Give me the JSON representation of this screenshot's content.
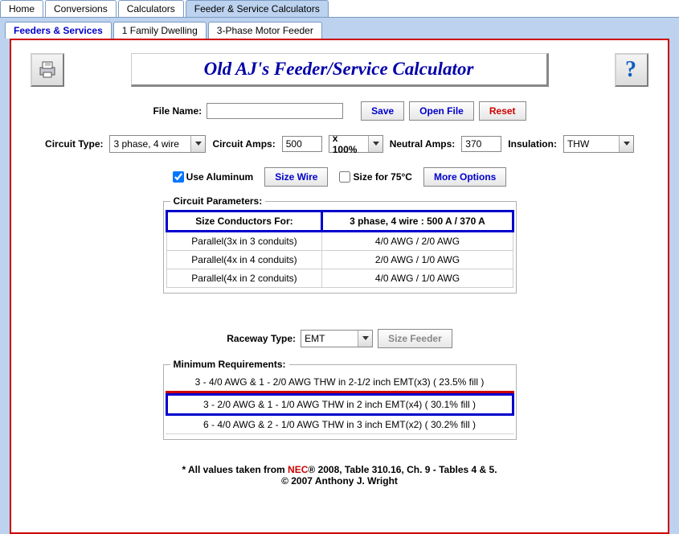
{
  "top_tabs": [
    "Home",
    "Conversions",
    "Calculators",
    "Feeder & Service Calculators"
  ],
  "top_tabs_selected": 3,
  "sub_tabs": [
    "Feeders & Services",
    "1 Family Dwelling",
    "3-Phase Motor Feeder"
  ],
  "sub_tabs_selected": 0,
  "title": "Old AJ's Feeder/Service Calculator",
  "file_name_label": "File Name:",
  "file_name_value": "",
  "buttons": {
    "save": "Save",
    "open": "Open File",
    "reset": "Reset",
    "size_wire": "Size Wire",
    "more_options": "More Options",
    "size_feeder": "Size Feeder"
  },
  "labels": {
    "circuit_type": "Circuit Type:",
    "circuit_amps": "Circuit Amps:",
    "multiplier": "x 100%",
    "neutral_amps": "Neutral Amps:",
    "insulation": "Insulation:",
    "use_aluminum": "Use Aluminum",
    "size_75": "Size for 75°C",
    "raceway_type": "Raceway Type:"
  },
  "values": {
    "circuit_type": "3 phase, 4 wire",
    "circuit_amps": "500",
    "neutral_amps": "370",
    "insulation": "THW",
    "use_aluminum": true,
    "size_75": false,
    "raceway_type": "EMT"
  },
  "params_legend": "Circuit Parameters:",
  "params_header": {
    "left": "Size Conductors For:",
    "right": "3 phase, 4 wire   :   500 A / 370 A"
  },
  "params_rows": [
    {
      "left": "Parallel(3x in 3 conduits)",
      "right": "4/0 AWG / 2/0 AWG"
    },
    {
      "left": "Parallel(4x in 4 conduits)",
      "right": "2/0 AWG / 1/0 AWG"
    },
    {
      "left": "Parallel(4x in 2 conduits)",
      "right": "4/0 AWG / 1/0 AWG"
    }
  ],
  "minreq_legend": "Minimum Requirements:",
  "minreq_rows": [
    "3 - 4/0 AWG & 1 - 2/0 AWG THW in 2-1/2 inch EMT(x3)  ( 23.5% fill )",
    "3 - 2/0 AWG & 1 - 1/0 AWG THW in 2 inch EMT(x4)  ( 30.1% fill )",
    "6 - 4/0 AWG & 2 - 1/0 AWG THW in 3 inch EMT(x2)  ( 30.2% fill )"
  ],
  "footer_pre": "* All values taken from ",
  "footer_nec": "NEC",
  "footer_post": "® 2008, Table 310.16, Ch. 9 - Tables 4 & 5.",
  "footer_copy": "© 2007 Anthony J. Wright"
}
